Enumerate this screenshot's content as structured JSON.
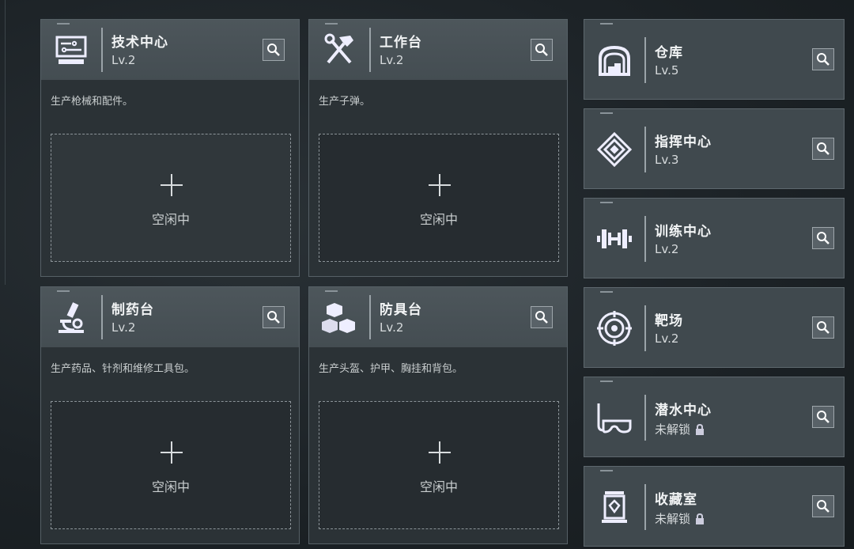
{
  "main_buildings": [
    {
      "name": "技术中心",
      "level": "Lv.2",
      "description": "生产枪械和配件。",
      "slot_label": "空闲中",
      "icon": "computer-icon"
    },
    {
      "name": "工作台",
      "level": "Lv.2",
      "description": "生产子弹。",
      "slot_label": "空闲中",
      "icon": "hammer-wrench-icon"
    },
    {
      "name": "制药台",
      "level": "Lv.2",
      "description": "生产药品、针剂和维修工具包。",
      "slot_label": "空闲中",
      "icon": "microscope-icon"
    },
    {
      "name": "防具台",
      "level": "Lv.2",
      "description": "生产头盔、护甲、胸挂和背包。",
      "slot_label": "空闲中",
      "icon": "boxes-icon"
    }
  ],
  "side_buildings": [
    {
      "name": "仓库",
      "level": "Lv.5",
      "locked": false,
      "icon": "warehouse-icon"
    },
    {
      "name": "指挥中心",
      "level": "Lv.3",
      "locked": false,
      "icon": "command-emblem-icon"
    },
    {
      "name": "训练中心",
      "level": "Lv.2",
      "locked": false,
      "icon": "dumbbell-icon"
    },
    {
      "name": "靶场",
      "level": "Lv.2",
      "locked": false,
      "icon": "target-icon"
    },
    {
      "name": "潜水中心",
      "level": "未解锁",
      "locked": true,
      "icon": "diving-mask-icon"
    },
    {
      "name": "收藏室",
      "level": "未解锁",
      "locked": true,
      "icon": "display-case-icon"
    }
  ],
  "colors": {
    "accent": "#e6e9ea",
    "panel": "#2b3236",
    "header": "#4d565b"
  }
}
